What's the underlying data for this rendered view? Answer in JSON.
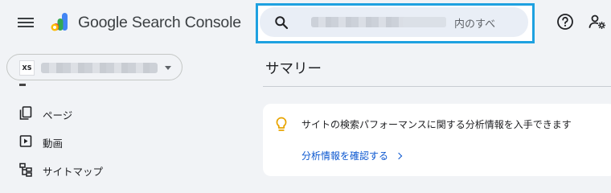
{
  "header": {
    "brand": "Google Search Console",
    "menu_icon": "hamburger-menu-icon",
    "logo_icon": "search-console-logo-icon",
    "search": {
      "icon": "search-icon",
      "suffix": "内のすべ"
    },
    "help_icon": "help-icon",
    "account_icon": "manage-account-icon",
    "highlight_color": "#1ea1e0"
  },
  "property_selector": {
    "badge": "XS",
    "dropdown_icon": "caret-down-icon"
  },
  "sidebar": {
    "items": [
      {
        "label": "ページ",
        "icon": "pages-icon"
      },
      {
        "label": "動画",
        "icon": "video-icon"
      },
      {
        "label": "サイトマップ",
        "icon": "sitemap-icon"
      }
    ]
  },
  "main": {
    "title": "サマリー",
    "card": {
      "icon": "lightbulb-icon",
      "text": "サイトの検索パフォーマンスに関する分析情報を入手できます",
      "link": "分析情報を確認する"
    }
  }
}
